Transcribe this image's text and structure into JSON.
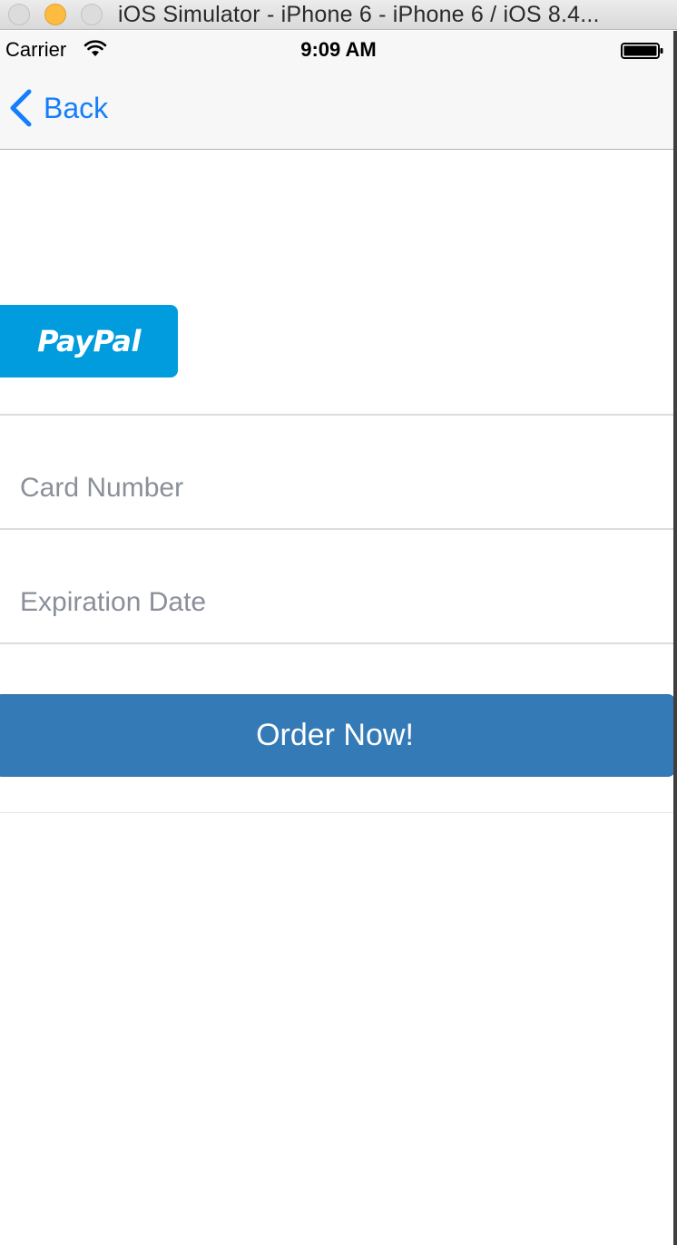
{
  "window": {
    "title": "iOS Simulator - iPhone 6 - iPhone 6 / iOS 8.4..."
  },
  "status_bar": {
    "carrier": "Carrier",
    "time": "9:09 AM"
  },
  "nav_bar": {
    "back_label": "Back"
  },
  "payment": {
    "paypal_label": "PayPal",
    "card_number_placeholder": "Card Number",
    "expiration_placeholder": "Expiration Date",
    "order_button_label": "Order Now!"
  },
  "colors": {
    "ios_tint": "#147efb",
    "paypal_blue": "#009cde",
    "order_button": "#337ab7"
  }
}
